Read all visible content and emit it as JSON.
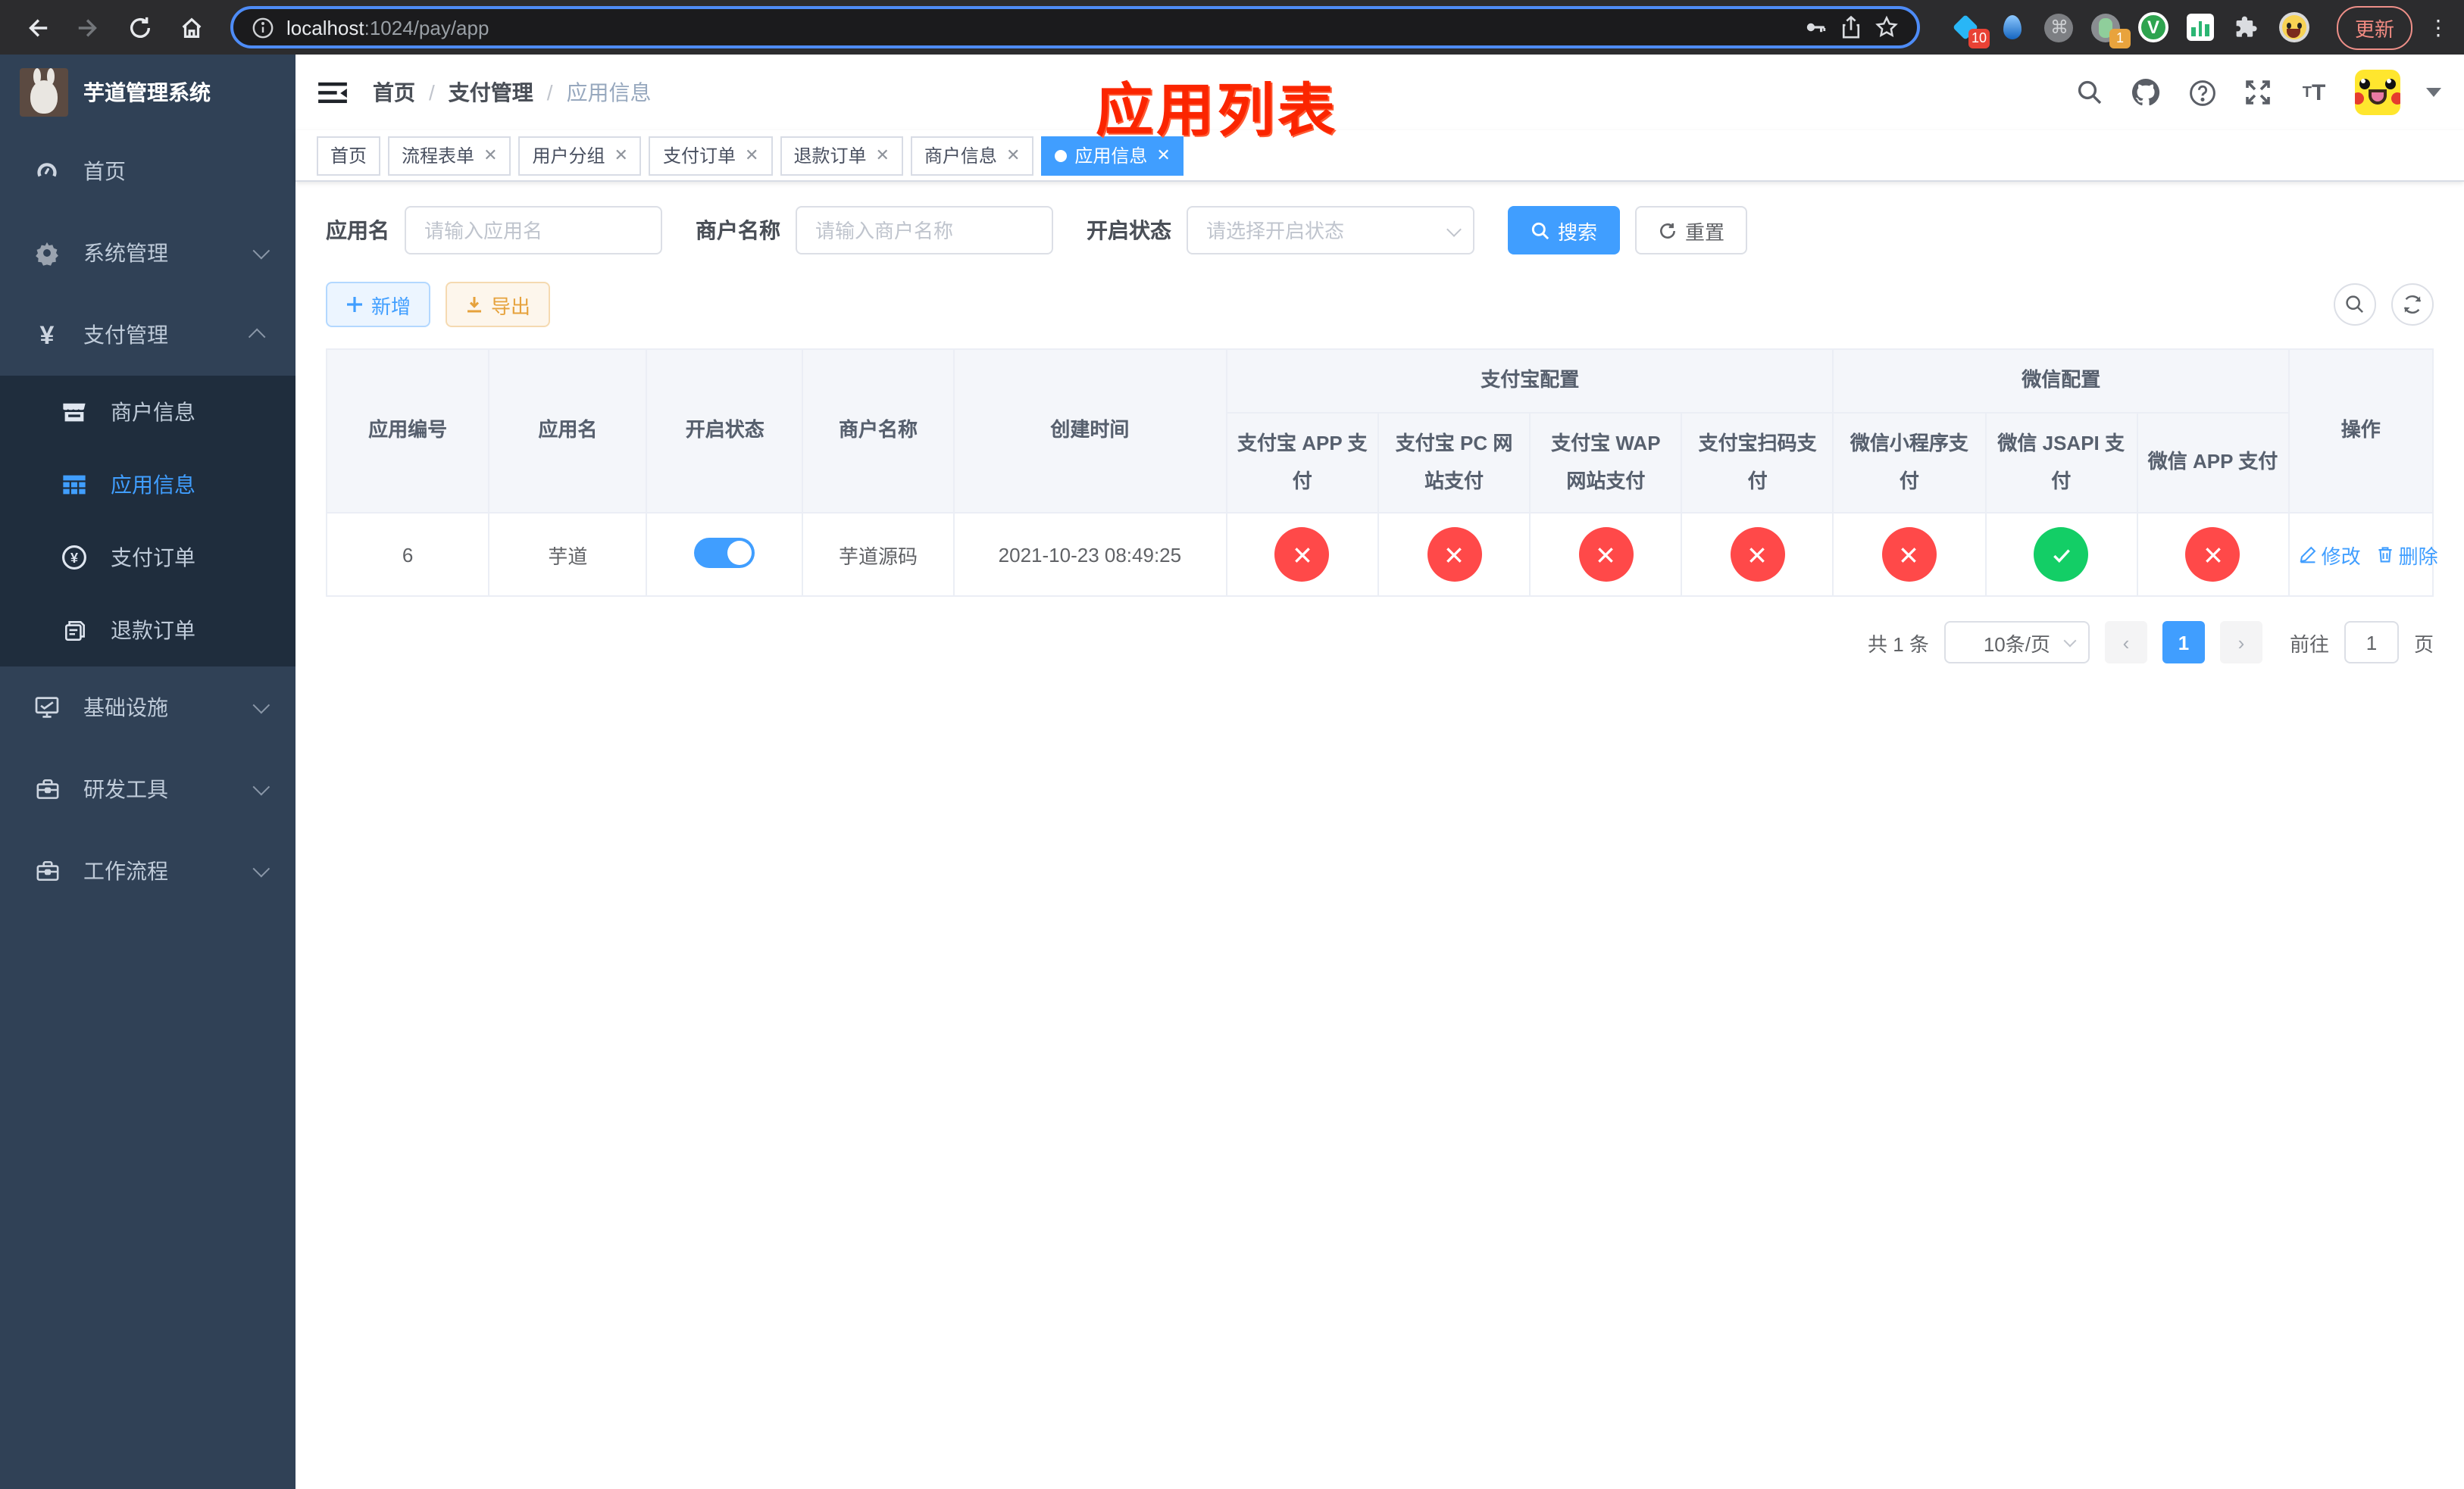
{
  "colors": {
    "accent": "#409eff",
    "success": "#13ce66",
    "danger": "#ff4949",
    "sidebar_bg": "#304156",
    "submenu_bg": "#1f2d3d",
    "warning": "#e6a23c"
  },
  "browser": {
    "url_host": "localhost",
    "url_path": ":1024/pay/app",
    "update_label": "更新",
    "ext_badge_blue_diamond": "10",
    "ext_badge_recorder": "1",
    "ext_v_letter": "V"
  },
  "app": {
    "title": "芋道管理系统"
  },
  "sidebar": {
    "items": [
      {
        "label": "首页",
        "icon": "dashboard-icon"
      },
      {
        "label": "系统管理",
        "icon": "gear-icon",
        "chevron": "down"
      },
      {
        "label": "支付管理",
        "icon": "yen-icon",
        "chevron": "up",
        "expanded": true,
        "children": [
          {
            "label": "商户信息",
            "icon": "store-icon"
          },
          {
            "label": "应用信息",
            "icon": "grid-icon",
            "active": true
          },
          {
            "label": "支付订单",
            "icon": "yen-circle-icon"
          },
          {
            "label": "退款订单",
            "icon": "document-icon"
          }
        ]
      },
      {
        "label": "基础设施",
        "icon": "monitor-icon",
        "chevron": "down"
      },
      {
        "label": "研发工具",
        "icon": "toolbox-icon",
        "chevron": "down"
      },
      {
        "label": "工作流程",
        "icon": "toolbox-icon",
        "chevron": "down"
      }
    ]
  },
  "header": {
    "breadcrumb": [
      "首页",
      "支付管理",
      "应用信息"
    ],
    "annotation": "应用列表"
  },
  "tabs": [
    {
      "label": "首页",
      "closable": false,
      "active": false
    },
    {
      "label": "流程表单",
      "closable": true,
      "active": false
    },
    {
      "label": "用户分组",
      "closable": true,
      "active": false
    },
    {
      "label": "支付订单",
      "closable": true,
      "active": false
    },
    {
      "label": "退款订单",
      "closable": true,
      "active": false
    },
    {
      "label": "商户信息",
      "closable": true,
      "active": false
    },
    {
      "label": "应用信息",
      "closable": true,
      "active": true
    }
  ],
  "filters": {
    "name_label": "应用名",
    "name_placeholder": "请输入应用名",
    "merchant_label": "商户名称",
    "merchant_placeholder": "请输入商户名称",
    "status_label": "开启状态",
    "status_placeholder": "请选择开启状态",
    "search_label": "搜索",
    "reset_label": "重置"
  },
  "toolbar": {
    "add_label": "新增",
    "export_label": "导出"
  },
  "table": {
    "columns": [
      "应用编号",
      "应用名",
      "开启状态",
      "商户名称",
      "创建时间"
    ],
    "groups": [
      {
        "label": "支付宝配置",
        "children": [
          "支付宝 APP 支付",
          "支付宝 PC 网站支付",
          "支付宝 WAP 网站支付",
          "支付宝扫码支付"
        ]
      },
      {
        "label": "微信配置",
        "children": [
          "微信小程序支付",
          "微信 JSAPI 支付",
          "微信 APP 支付"
        ]
      }
    ],
    "op_label": "操作",
    "rows": [
      {
        "id": "6",
        "name": "芋道",
        "enabled": true,
        "merchant": "芋道源码",
        "created": "2021-10-23 08:49:25",
        "channels": [
          false,
          false,
          false,
          false,
          false,
          true,
          false
        ],
        "actions": [
          {
            "label": "修改",
            "icon": "edit-icon"
          },
          {
            "label": "删除",
            "icon": "trash-icon"
          }
        ]
      }
    ]
  },
  "pagination": {
    "total_label": "共 1 条",
    "page_size_label": "10条/页",
    "current_page": "1",
    "goto_label": "前往",
    "goto_value": "1",
    "page_unit_label": "页"
  }
}
